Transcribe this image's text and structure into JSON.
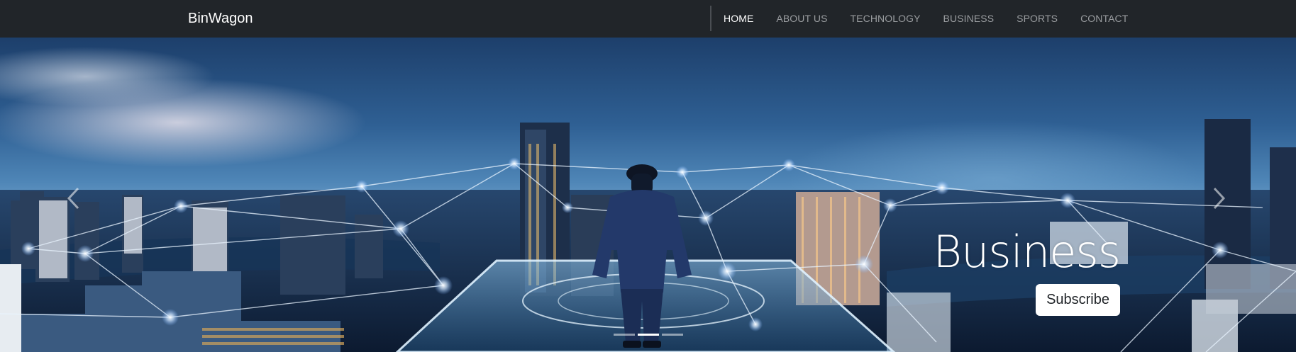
{
  "navbar": {
    "brand": "BinWagon",
    "links": [
      {
        "label": "HOME",
        "active": true
      },
      {
        "label": "ABOUT US",
        "active": false
      },
      {
        "label": "TECHNOLOGY",
        "active": false
      },
      {
        "label": "BUSINESS",
        "active": false
      },
      {
        "label": "SPORTS",
        "active": false
      },
      {
        "label": "CONTACT",
        "active": false
      }
    ]
  },
  "hero": {
    "caption_title": "Business",
    "button_label": "Subscribe",
    "slide_count": 3,
    "active_slide": 2
  },
  "icons": {
    "prev": "chevron-left-icon",
    "next": "chevron-right-icon"
  },
  "colors": {
    "navbar_bg": "#212529",
    "nav_active": "#ffffff",
    "nav_inactive": "#9a9da0",
    "button_bg": "#ffffff"
  }
}
